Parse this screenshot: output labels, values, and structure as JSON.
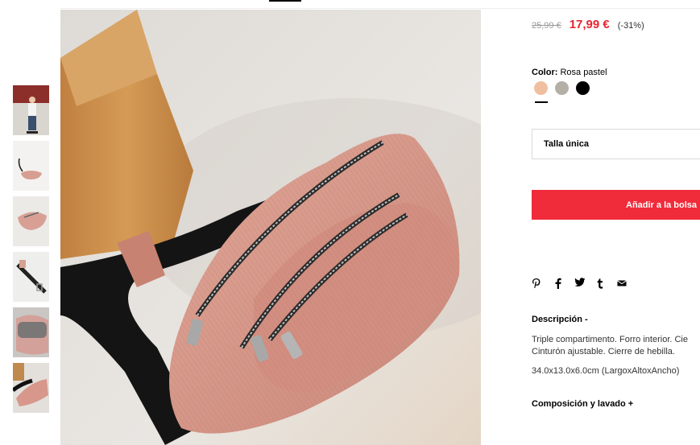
{
  "product": {
    "old_price": "25,99 €",
    "new_price": "17,99 €",
    "discount": "(-31%)",
    "color_label": "Color:",
    "color_value": "Rosa pastel",
    "swatches": [
      {
        "name": "rosa pastel",
        "color": "#f0bfa0"
      },
      {
        "name": "gris",
        "color": "#b5b0a6"
      },
      {
        "name": "negro",
        "color": "#000000"
      }
    ],
    "size": "Talla única",
    "add_to_bag": "Añadir a la bolsa",
    "share": {
      "pinterest": "P",
      "facebook": "f",
      "twitter": "twitter-bird",
      "tumblr": "t",
      "email": "envelope"
    },
    "description_title": "Descripción -",
    "description_lines": [
      "Triple compartimento. Forro interior. Cie",
      "Cinturón ajustable. Cierre de hebilla."
    ],
    "dimensions": "34.0x13.0x6.0cm (LargoxAltoxAncho)",
    "composition_title": "Composición y lavado +"
  },
  "colors": {
    "accent_red": "#e8242e",
    "button_red": "#f02b3a",
    "bag_pink": "#d99a8c"
  }
}
